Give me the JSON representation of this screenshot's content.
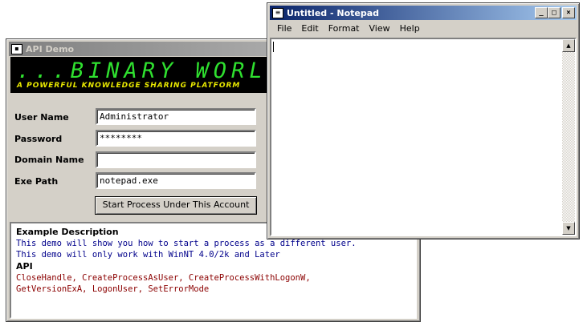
{
  "api_demo": {
    "title": "API Demo",
    "banner": {
      "title": "...BINARY WORLD",
      "subtitle": "A POWERFUL KNOWLEDGE SHARING PLATFORM"
    },
    "form": {
      "user_name_label": "User Name",
      "user_name_value": "Administrator",
      "password_label": "Password",
      "password_value": "********",
      "domain_label": "Domain Name",
      "domain_value": "",
      "exe_path_label": "Exe Path",
      "exe_path_value": "notepad.exe",
      "start_button": "Start Process Under This Account"
    },
    "description": {
      "heading": "Example Description",
      "line1": "This demo will show you how to start a process as a different user.",
      "line2": "This demo will only work with WinNT 4.0/2k and Later",
      "api_heading": "API",
      "api_line1": "CloseHandle, CreateProcessAsUser, CreateProcessWithLogonW,",
      "api_line2": "GetVersionExA, LogonUser, SetErrorMode"
    }
  },
  "notepad": {
    "title": "Untitled - Notepad",
    "menu": [
      "File",
      "Edit",
      "Format",
      "View",
      "Help"
    ],
    "content": ""
  },
  "colors": {
    "window_face": "#d4d0c8",
    "active_title": "#0a246a",
    "inactive_title": "#808080",
    "banner_green": "#2fe02f",
    "banner_yellow": "#e8e800"
  }
}
